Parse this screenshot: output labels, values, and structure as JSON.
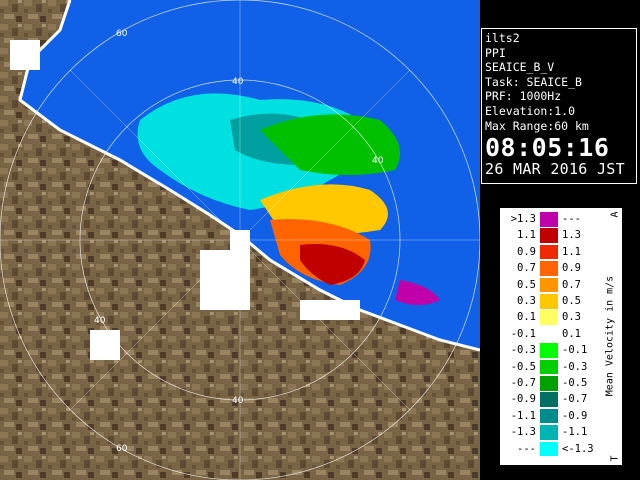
{
  "info": {
    "station": "ilts2",
    "product": "PPI",
    "scan": "SEAICE_B_V",
    "task": "Task: SEAICE_B",
    "prf": "PRF: 1000Hz",
    "elevation": "Elevation:1.0",
    "max_range": "Max Range:60 km",
    "time": "08:05:16",
    "date": "26 MAR 2016 JST"
  },
  "legend": {
    "title": "Mean Velocity in m/s",
    "top_mark": "A",
    "bottom_mark": "T",
    "rows": [
      {
        "lo": ">1.3",
        "hi": "---",
        "color": "#c000a8"
      },
      {
        "lo": "1.1",
        "hi": "1.3",
        "color": "#c00000"
      },
      {
        "lo": "0.9",
        "hi": "1.1",
        "color": "#f02800"
      },
      {
        "lo": "0.7",
        "hi": "0.9",
        "color": "#ff6400"
      },
      {
        "lo": "0.5",
        "hi": "0.7",
        "color": "#ff9600"
      },
      {
        "lo": "0.3",
        "hi": "0.5",
        "color": "#ffc800"
      },
      {
        "lo": "0.1",
        "hi": "0.3",
        "color": "#ffff60"
      },
      {
        "lo": "-0.1",
        "hi": "0.1",
        "color": "#ffffff"
      },
      {
        "lo": "-0.3",
        "hi": "-0.1",
        "color": "#00ff00"
      },
      {
        "lo": "-0.5",
        "hi": "-0.3",
        "color": "#00d000"
      },
      {
        "lo": "-0.7",
        "hi": "-0.5",
        "color": "#00a000"
      },
      {
        "lo": "-0.9",
        "hi": "-0.7",
        "color": "#007060"
      },
      {
        "lo": "-1.1",
        "hi": "-0.9",
        "color": "#008c8c"
      },
      {
        "lo": "-1.3",
        "hi": "-1.1",
        "color": "#00b4b4"
      },
      {
        "lo": "---",
        "hi": "<-1.3",
        "color": "#00ffff"
      }
    ]
  },
  "map": {
    "range_labels": {
      "r40_top": "40",
      "r60_top": "60",
      "r40_right": "40",
      "r40_left": "40",
      "r40_bottom": "40",
      "r60_bottom": "60"
    },
    "colors": {
      "sea": "#1060e8",
      "land": "#7a6446",
      "coast": "#ffffff"
    }
  }
}
